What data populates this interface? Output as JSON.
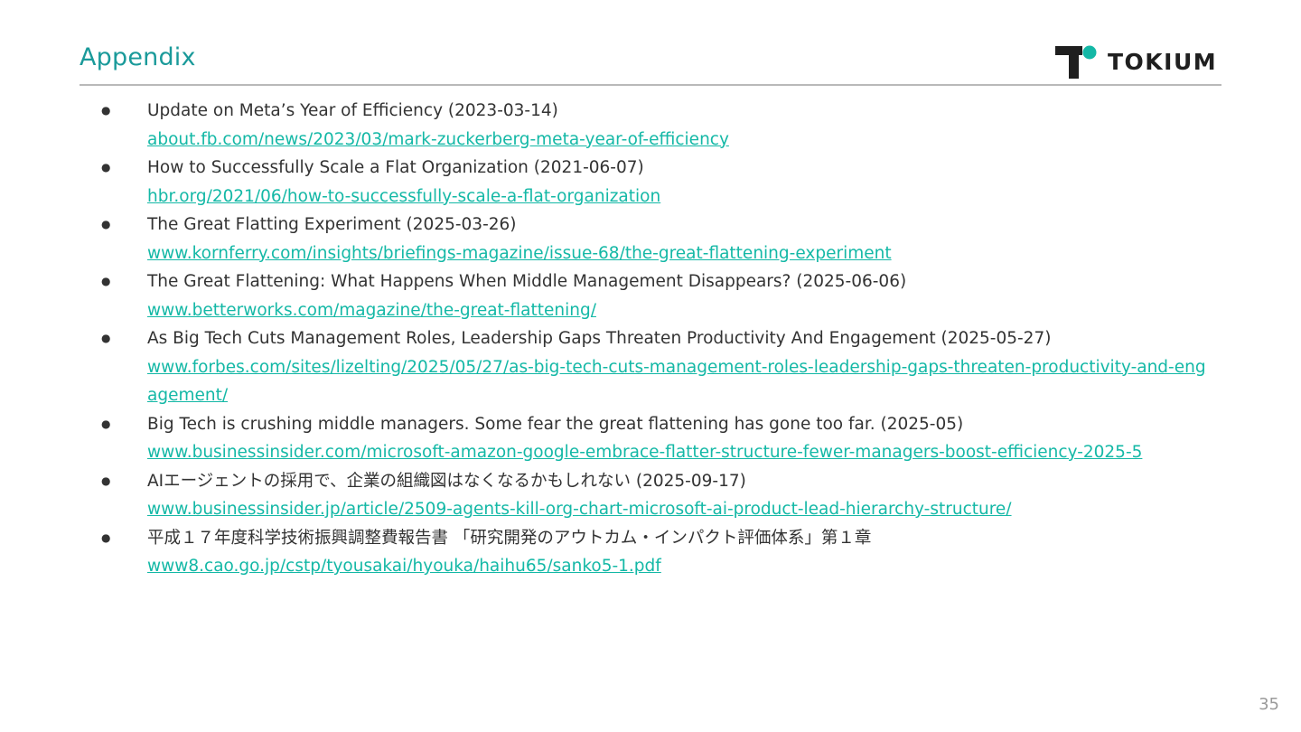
{
  "slide": {
    "title": "Appendix",
    "page_number": "35"
  },
  "brand": {
    "logo_text": "TOKIUM",
    "logo_icon": "tokium-logo-icon",
    "accent_color": "#1a9a9a",
    "logo_dot_color": "#14b8a6"
  },
  "colors": {
    "link": "#14b8a6",
    "text": "#333333",
    "rule": "#b9b9b9"
  },
  "references": [
    {
      "bullet": "●",
      "title": "Update on Meta’s Year of Efficiency (2023-03-14)",
      "url": "about.fb.com/news/2023/03/mark-zuckerberg-meta-year-of-efficiency"
    },
    {
      "bullet": "●",
      "title": "How to Successfully Scale a Flat Organization (2021-06-07)",
      "url": "hbr.org/2021/06/how-to-successfully-scale-a-flat-organization"
    },
    {
      "bullet": "●",
      "title": "The Great Flatting Experiment (2025-03-26)",
      "url": "www.kornferry.com/insights/briefings-magazine/issue-68/the-great-flattening-experiment"
    },
    {
      "bullet": "●",
      "title": "The Great Flattening: What Happens When Middle Management Disappears? (2025-06-06)",
      "url": "www.betterworks.com/magazine/the-great-flattening/"
    },
    {
      "bullet": "●",
      "title": "As Big Tech Cuts Management Roles, Leadership Gaps Threaten Productivity And Engagement (2025-05-27)",
      "url": "www.forbes.com/sites/lizelting/2025/05/27/as-big-tech-cuts-management-roles-leadership-gaps-threaten-productivity-and-engagement/"
    },
    {
      "bullet": "●",
      "title": "Big Tech is crushing middle managers. Some fear the great flattening has gone too far. (2025-05)",
      "url": "www.businessinsider.com/microsoft-amazon-google-embrace-flatter-structure-fewer-managers-boost-efficiency-2025-5"
    },
    {
      "bullet": "●",
      "title": "AIエージェントの採用で、企業の組織図はなくなるかもしれない (2025-09-17)",
      "url": "www.businessinsider.jp/article/2509-agents-kill-org-chart-microsoft-ai-product-lead-hierarchy-structure/"
    },
    {
      "bullet": "●",
      "title": "平成１７年度科学技術振興調整費報告書 「研究開発のアウトカム・インパクト評価体系」第１章",
      "url": "www8.cao.go.jp/cstp/tyousakai/hyouka/haihu65/sanko5-1.pdf"
    }
  ]
}
